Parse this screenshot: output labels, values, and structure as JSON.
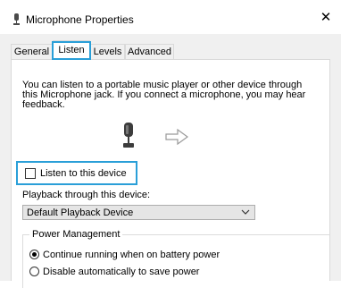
{
  "window": {
    "title": "Microphone Properties",
    "close_glyph": "✕"
  },
  "tabs": [
    {
      "label": "General"
    },
    {
      "label": "Listen",
      "selected": true
    },
    {
      "label": "Levels"
    },
    {
      "label": "Advanced"
    }
  ],
  "listen_tab": {
    "description_lines": [
      "You can listen to a portable music player or other device through",
      "this Microphone jack.  If you connect a microphone, you may hear",
      "feedback."
    ],
    "listen_checkbox": {
      "label": "Listen to this device",
      "checked": false
    },
    "playback_label": "Playback through this device:",
    "playback_value": "Default Playback Device",
    "power_management": {
      "title": "Power Management",
      "options": [
        {
          "label": "Continue running when on battery power",
          "selected": true
        },
        {
          "label": "Disable automatically to save power",
          "selected": false
        }
      ]
    }
  },
  "icons": {
    "title": "microphone-icon",
    "device": "microphone-icon",
    "arrow": "right-arrow-icon",
    "dropdown": "chevron-down-icon"
  },
  "colors": {
    "highlight": "#2a9fd8",
    "dialog_bg": "#f0f0f0",
    "panel_bg": "#ffffff"
  }
}
